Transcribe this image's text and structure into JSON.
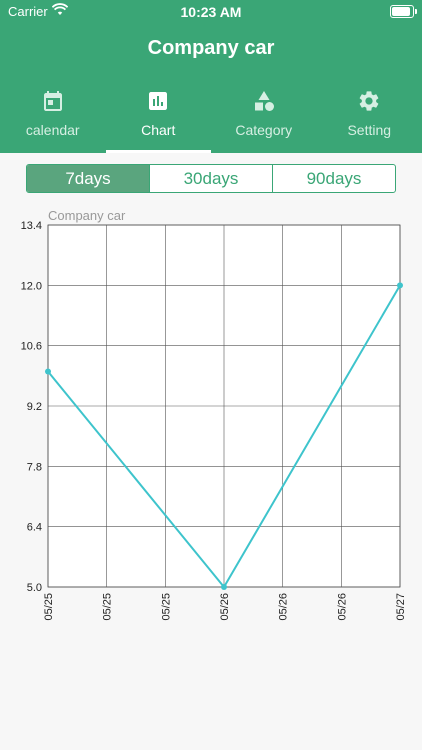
{
  "status": {
    "carrier": "Carrier",
    "time": "10:23 AM"
  },
  "header": {
    "title": "Company car"
  },
  "tabs": [
    {
      "label": "calendar",
      "icon": "calendar-icon",
      "active": false
    },
    {
      "label": "Chart",
      "icon": "bar-chart-icon",
      "active": true
    },
    {
      "label": "Category",
      "icon": "category-shapes-icon",
      "active": false
    },
    {
      "label": "Setting",
      "icon": "gear-icon",
      "active": false
    }
  ],
  "range": {
    "options": [
      "7days",
      "30days",
      "90days"
    ],
    "selected": "7days"
  },
  "colors": {
    "header": "#3aa676",
    "line": "#3ec4cc",
    "segment_active": "#5aa57e"
  },
  "chart_data": {
    "type": "line",
    "title": "Company car",
    "x": [
      "05/25",
      "05/25",
      "05/25",
      "05/26",
      "05/26",
      "05/26",
      "05/27"
    ],
    "yticks": [
      "13.4",
      "12.0",
      "10.6",
      "9.2",
      "7.8",
      "6.4",
      "5.0"
    ],
    "ylim": [
      5.0,
      13.4
    ],
    "grid": true,
    "series": [
      {
        "points": [
          {
            "x": 0,
            "y": 10.0
          },
          {
            "x": 3,
            "y": 5.0
          },
          {
            "x": 6,
            "y": 12.0
          }
        ]
      }
    ]
  }
}
